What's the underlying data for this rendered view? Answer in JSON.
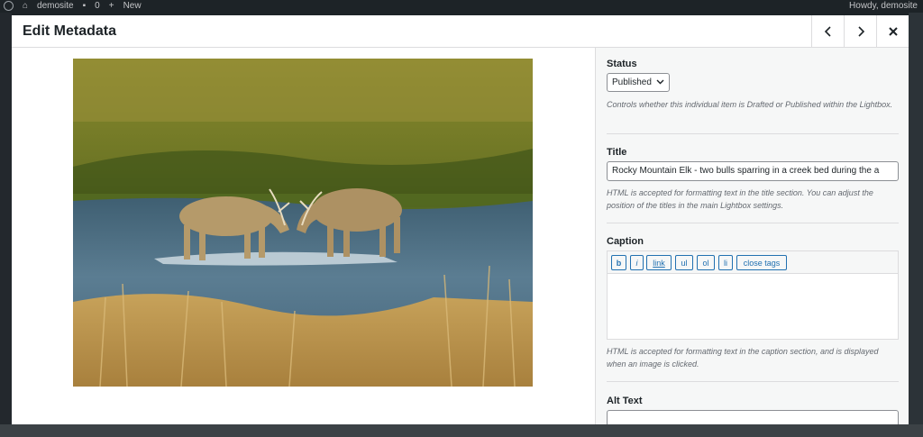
{
  "adminbar": {
    "site_name": "demosite",
    "comments_count": "0",
    "new_label": "New",
    "greeting": "Howdy, demosite"
  },
  "modal": {
    "title": "Edit Metadata",
    "prev_icon": "chevron-left-icon",
    "next_icon": "chevron-right-icon",
    "close_icon": "close-icon"
  },
  "sidebar": {
    "status": {
      "label": "Status",
      "value": "Published",
      "description": "Controls whether this individual item is Drafted or Published within the Lightbox."
    },
    "title": {
      "label": "Title",
      "value": "Rocky Mountain Elk - two bulls sparring in a creek bed during the a",
      "description": "HTML is accepted for formatting text in the title section. You can adjust the position of the titles in the main Lightbox settings."
    },
    "caption": {
      "label": "Caption",
      "buttons": [
        "b",
        "i",
        "link",
        "ul",
        "ol",
        "li",
        "close tags"
      ],
      "value": "",
      "description": "HTML is accepted for formatting text in the caption section, and is displayed when an image is clicked."
    },
    "alt_text": {
      "label": "Alt Text",
      "value": ""
    }
  },
  "colors": {
    "accent": "#2271b1",
    "adminbar": "#1d2327",
    "sidebar_bg": "#f6f7f7"
  }
}
